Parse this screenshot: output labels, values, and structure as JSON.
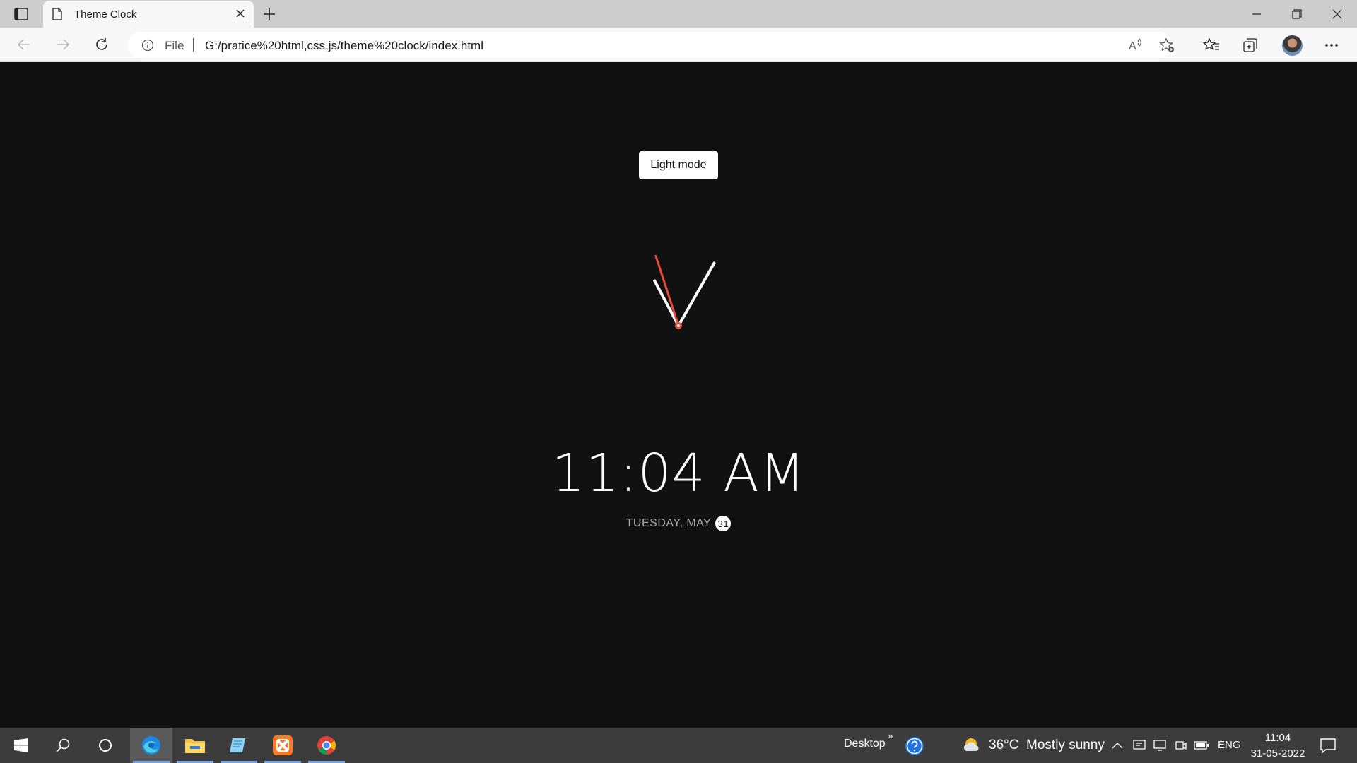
{
  "browser": {
    "tab_title": "Theme Clock",
    "omnibox": {
      "file_label": "File",
      "url": "G:/pratice%20html,css,js/theme%20clock/index.html"
    }
  },
  "page": {
    "toggle_label": "Light mode",
    "clock": {
      "hour": 11,
      "minute": 4,
      "second": 57
    },
    "time_text": "11:04 AM",
    "date_text": "TUESDAY, MAY",
    "date_day": "31"
  },
  "taskbar": {
    "apps": [
      "start-icon",
      "search-icon",
      "cortana-icon",
      "edge-icon",
      "file-explorer-icon",
      "notepad-icon",
      "xampp-icon",
      "chrome-icon"
    ],
    "desktop_label": "Desktop",
    "weather": {
      "temp": "36°C",
      "condition": "Mostly sunny"
    },
    "language": "ENG",
    "time": "11:04",
    "date": "31-05-2022"
  },
  "colors": {
    "page_bg": "#111111",
    "hand_color": "#ffffff",
    "second_hand_color": "#e74c3c",
    "taskbar_bg": "#3c3c3c"
  }
}
